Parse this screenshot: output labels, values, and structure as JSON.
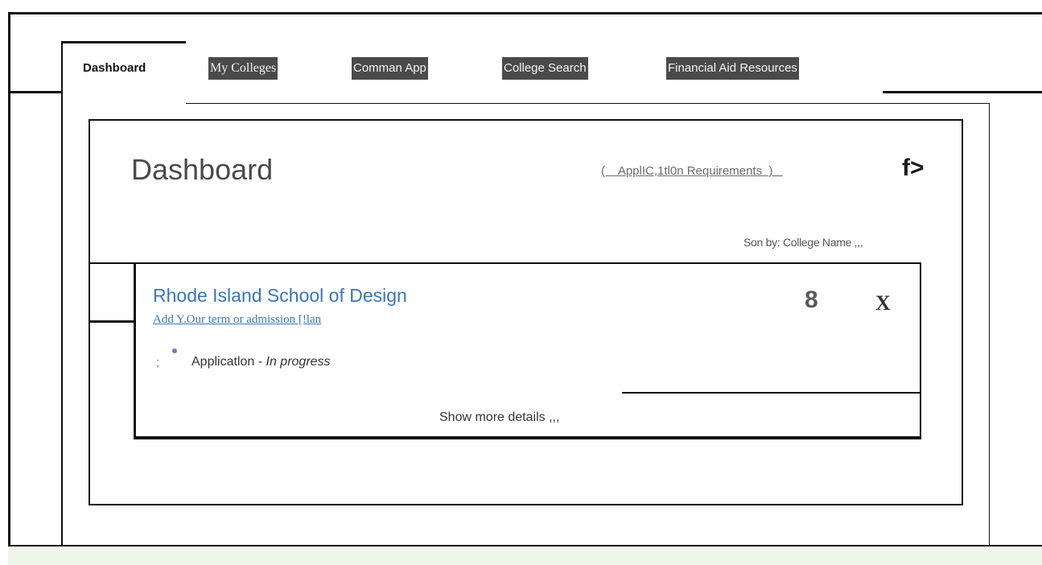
{
  "nav": {
    "tabs": [
      {
        "label": "Dashboard",
        "active": true
      },
      {
        "label": "My Colleges",
        "active": false
      },
      {
        "label": "Comman App",
        "active": false
      },
      {
        "label": "College Search",
        "active": false
      },
      {
        "label": "Financial Aid Resources",
        "active": false
      }
    ]
  },
  "dashboard": {
    "title": "Dashboard",
    "requirements_link": "(    ApplIC,1tl0n Requirements  )   ",
    "f_icon": "f>",
    "sort_label": "Son by: College Name ,,,"
  },
  "college_card": {
    "name": "Rhode Island School of Design",
    "term_link": "Add Y.Our term or admission [!lan",
    "count": "8",
    "close": "X",
    "bullet_prefix": ";",
    "application_label": "Applicatlon -",
    "application_status": "In progress",
    "show_more": "Show more details ,,,"
  },
  "colors": {
    "link_blue": "#3a76b7",
    "tab_dark": "#4a4a4a",
    "status_dot": "#8e6bb8",
    "footer_bg": "#eef5e8"
  }
}
